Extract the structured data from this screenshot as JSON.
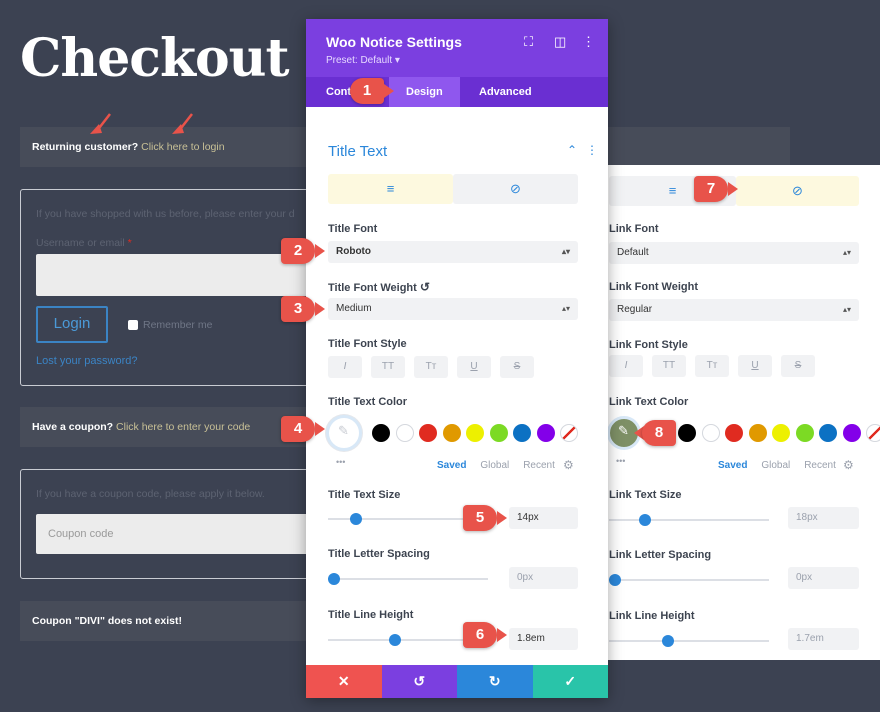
{
  "page": {
    "title": "Checkout",
    "notice1": {
      "label": "Returning customer?",
      "link": "Click here to login"
    },
    "login_box": {
      "intro": "If you have shopped with us before, please enter your d",
      "username_label": "Username or email",
      "required_mark": "*",
      "login_button": "Login",
      "remember": "Remember me",
      "lost_password": "Lost your password?"
    },
    "notice2": {
      "label": "Have a coupon?",
      "link": "Click here to enter your code"
    },
    "coupon_box": {
      "intro": "If you have a coupon code, please apply it below.",
      "placeholder": "Coupon code"
    },
    "notice3": {
      "label": "Coupon \"DIVI\" does not exist!"
    }
  },
  "panel": {
    "title": "Woo Notice Settings",
    "preset": "Preset: Default ▾",
    "tabs": [
      "Content",
      "Design",
      "Advanced"
    ],
    "section": "Title Text",
    "title_font": {
      "label": "Title Font",
      "value": "Roboto"
    },
    "title_font_weight": {
      "label": "Title Font Weight",
      "value": "Medium"
    },
    "title_font_style": {
      "label": "Title Font Style",
      "buttons": [
        "I",
        "TT",
        "Tт",
        "U",
        "S"
      ]
    },
    "title_text_color": {
      "label": "Title Text Color"
    },
    "title_text_size": {
      "label": "Title Text Size",
      "value": "14px",
      "level": 0.15
    },
    "title_letter_spacing": {
      "label": "Title Letter Spacing",
      "value": "0px",
      "level": 0.0
    },
    "title_line_height": {
      "label": "Title Line Height",
      "value": "1.8em",
      "level": 0.41
    },
    "color_tabs": {
      "saved": "Saved",
      "global": "Global",
      "recent": "Recent"
    },
    "dots": "•••"
  },
  "link_panel": {
    "link_font": {
      "label": "Link Font",
      "value": "Default"
    },
    "link_font_weight": {
      "label": "Link Font Weight",
      "value": "Regular"
    },
    "link_font_style": {
      "label": "Link Font Style"
    },
    "link_text_color": {
      "label": "Link Text Color"
    },
    "link_text_size": {
      "label": "Link Text Size",
      "value": "18px",
      "level": 0.2
    },
    "link_letter_spacing": {
      "label": "Link Letter Spacing",
      "value": "0px",
      "level": 0.0
    },
    "link_line_height": {
      "label": "Link Line Height",
      "value": "1.7em",
      "level": 0.36
    }
  },
  "swatches": [
    "#000000",
    "#ffffff",
    "#e02b20",
    "#e09900",
    "#edf000",
    "#7cda24",
    "#0c71c3",
    "#8300e9"
  ],
  "colors": {
    "accent": "#7b3fe0",
    "blue": "#2b87da",
    "red": "#ef5350",
    "green": "#29c4a9",
    "marker": "#e8534a"
  },
  "markers": [
    "1",
    "2",
    "3",
    "4",
    "5",
    "6",
    "7",
    "8"
  ]
}
